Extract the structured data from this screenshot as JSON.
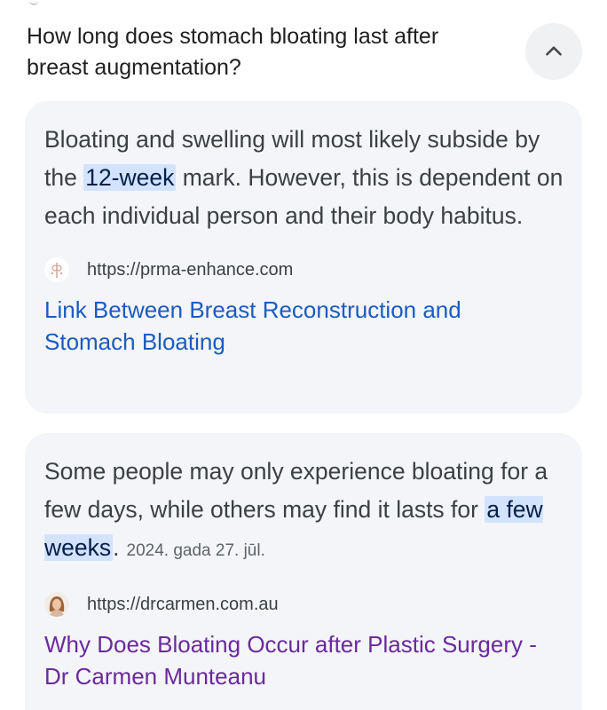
{
  "question": "How long does stomach bloating last after breast augmentation?",
  "icons": {
    "collapse": "chevron-up-icon",
    "favicon1": "prma-logo-icon",
    "favicon2": "doctor-avatar-icon"
  },
  "colors": {
    "card_bg": "#f3f5f8",
    "highlight_bg": "#d3e3fd",
    "link_blue": "#1a5bc1",
    "link_visited": "#6a2a9c"
  },
  "results": [
    {
      "snippet_before": "Bloating and swelling will most likely subside by the ",
      "snippet_highlight": "12-week",
      "snippet_after": " mark. However, this is dependent on each individual person and their body habitus.",
      "date": "",
      "url": "https://prma-enhance.com",
      "title": "Link Between Breast Reconstruction and Stomach Bloating"
    },
    {
      "snippet_before": "Some people may only experience bloating for a few days, while others may find it lasts for ",
      "snippet_highlight": "a few weeks",
      "snippet_after": ".",
      "date": "2024. gada 27. jūl.",
      "url": "https://drcarmen.com.au",
      "title": "Why Does Bloating Occur after Plastic Surgery - Dr Carmen Munteanu"
    }
  ]
}
